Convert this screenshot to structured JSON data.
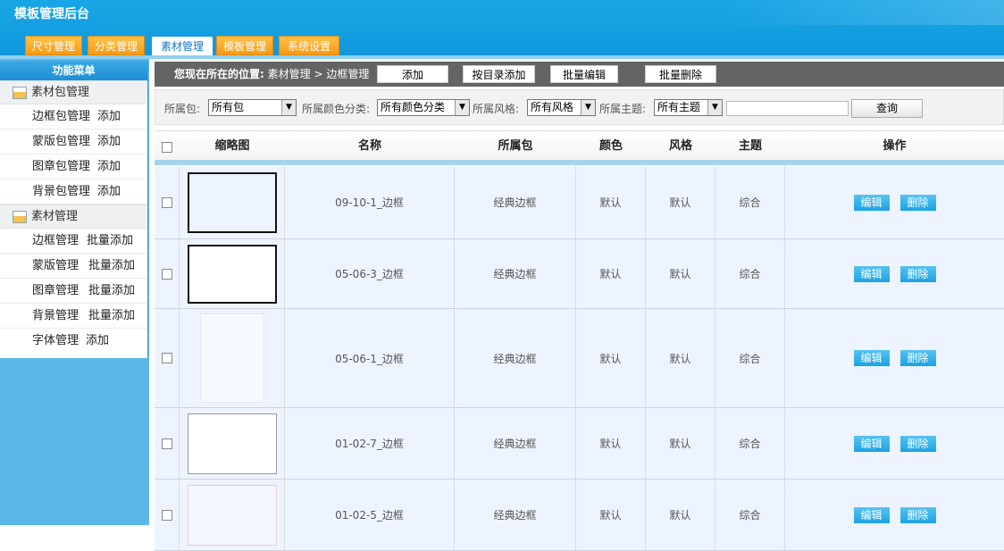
{
  "app": {
    "title": "模板管理后台"
  },
  "tabs": [
    {
      "label": "尺寸管理"
    },
    {
      "label": "分类管理"
    },
    {
      "label": "素材管理",
      "active": true
    },
    {
      "label": "模板管理"
    },
    {
      "label": "系统设置"
    }
  ],
  "sidebar": {
    "title": "功能菜单",
    "sections": [
      {
        "label": "素材包管理",
        "items": [
          {
            "label": "边框包管理",
            "action": "添加"
          },
          {
            "label": "蒙版包管理",
            "action": "添加"
          },
          {
            "label": "图章包管理",
            "action": "添加"
          },
          {
            "label": "背景包管理",
            "action": "添加"
          }
        ]
      },
      {
        "label": "素材管理",
        "items": [
          {
            "label": "边框管理",
            "action": "批量添加"
          },
          {
            "label": "蒙版管理",
            "action": "批量添加"
          },
          {
            "label": "图章管理",
            "action": "批量添加"
          },
          {
            "label": "背景管理",
            "action": "批量添加"
          },
          {
            "label": "字体管理",
            "action": "添加"
          }
        ]
      }
    ]
  },
  "location": {
    "prefix": "您现在所在的位置:",
    "path": "素材管理 > 边框管理",
    "buttons": {
      "add": "添加",
      "add_by_dir": "按目录添加",
      "batch_edit": "批量编辑",
      "batch_delete": "批量删除"
    }
  },
  "filters": {
    "package_label": "所属包:",
    "package_value": "所有包",
    "color_label": "所属颜色分类:",
    "color_value": "所有颜色分类",
    "style_label": "所属风格:",
    "style_value": "所有风格",
    "theme_label": "所属主题:",
    "theme_value": "所有主题",
    "search_value": "",
    "query_label": "查询"
  },
  "table": {
    "headers": {
      "thumb": "缩略图",
      "name": "名称",
      "package": "所属包",
      "color": "颜色",
      "style": "风格",
      "theme": "主题",
      "ops": "操作"
    },
    "edit_label": "编辑",
    "delete_label": "删除",
    "rows": [
      {
        "name": "09-10-1_边框",
        "package": "经典边框",
        "color": "默认",
        "style": "默认",
        "theme": "综合"
      },
      {
        "name": "05-06-3_边框",
        "package": "经典边框",
        "color": "默认",
        "style": "默认",
        "theme": "综合"
      },
      {
        "name": "05-06-1_边框",
        "package": "经典边框",
        "color": "默认",
        "style": "默认",
        "theme": "综合"
      },
      {
        "name": "01-02-7_边框",
        "package": "经典边框",
        "color": "默认",
        "style": "默认",
        "theme": "综合"
      },
      {
        "name": "01-02-5_边框",
        "package": "经典边框",
        "color": "默认",
        "style": "默认",
        "theme": "综合"
      }
    ]
  },
  "colors": {
    "header": "#0f98dc",
    "tab": "#f79a12",
    "button": "#1ba2e2",
    "locbar": "#646464"
  }
}
